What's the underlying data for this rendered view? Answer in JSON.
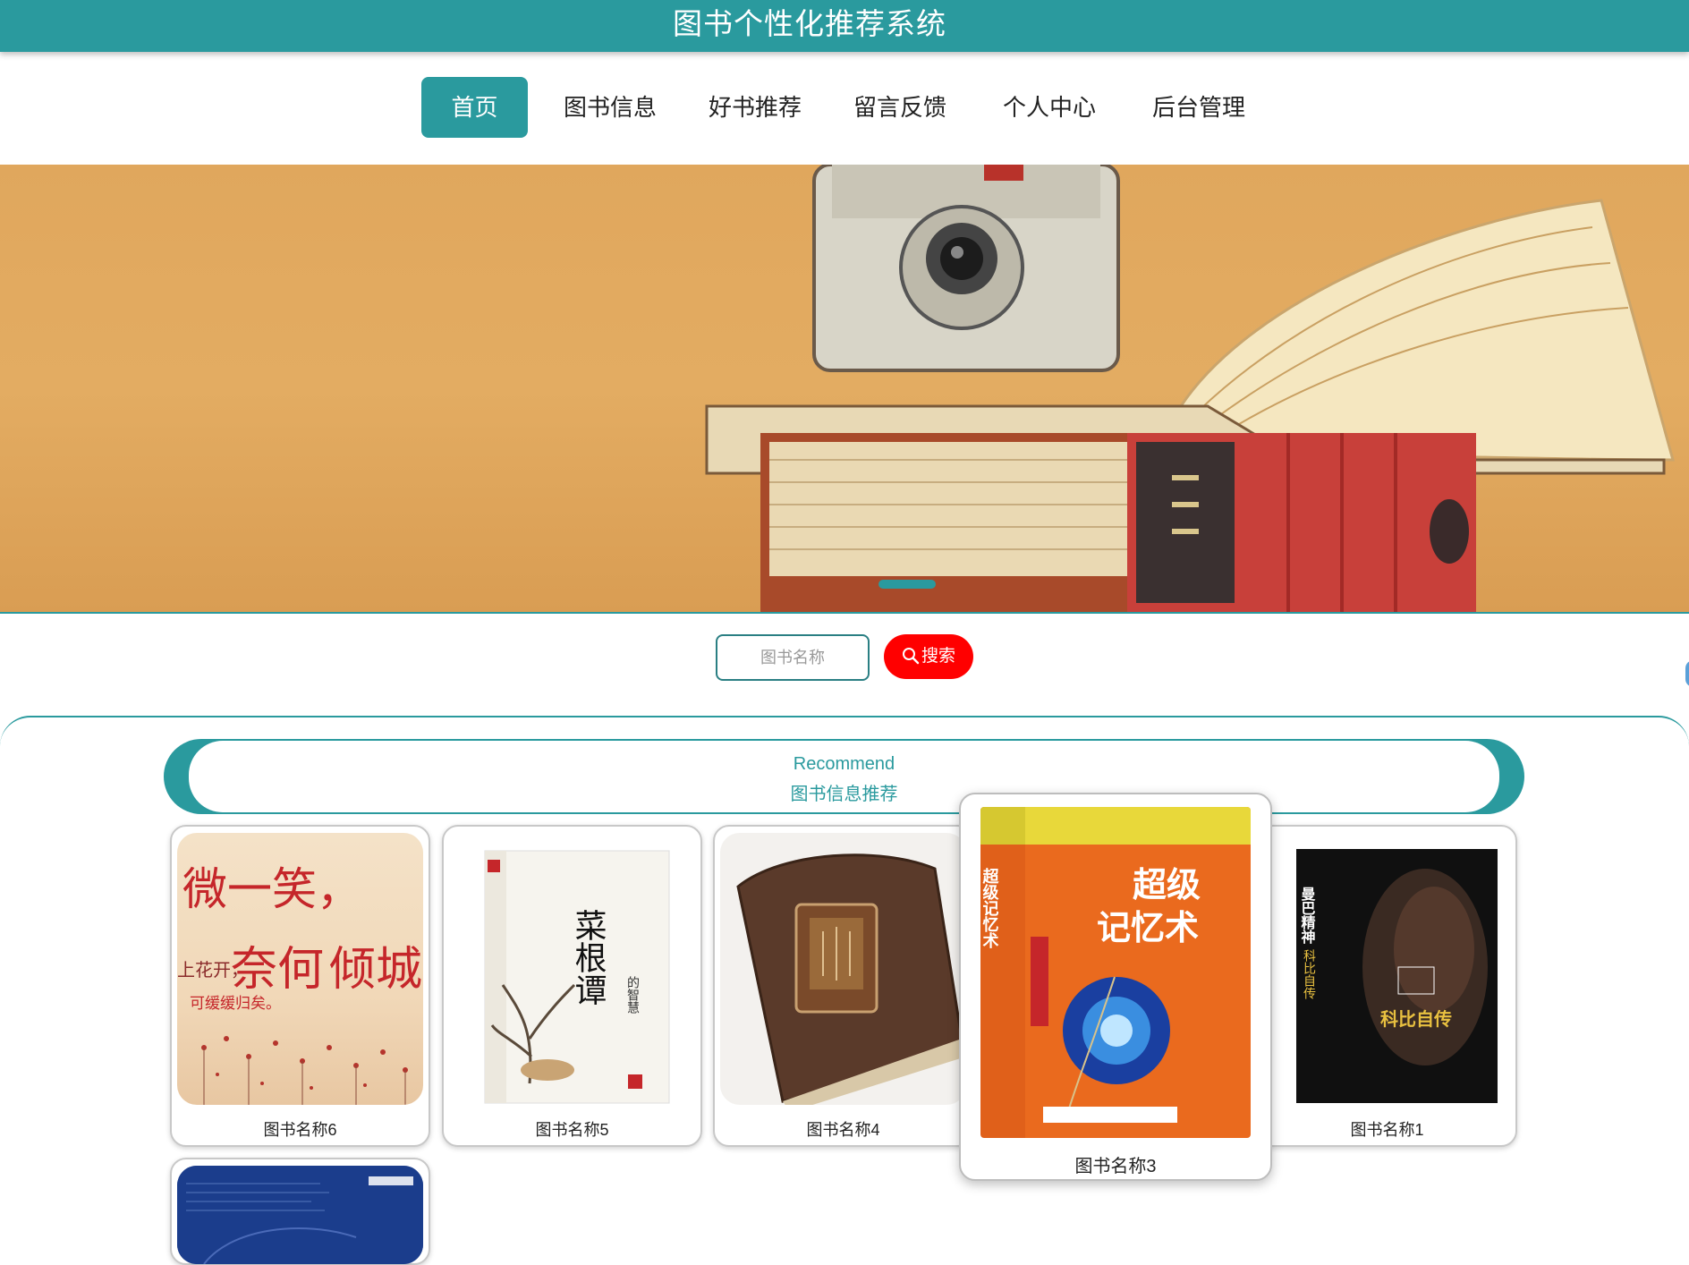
{
  "header": {
    "title": "图书个性化推荐系统"
  },
  "nav": {
    "items": [
      {
        "label": "首页",
        "active": true
      },
      {
        "label": "图书信息"
      },
      {
        "label": "好书推荐"
      },
      {
        "label": "留言反馈"
      },
      {
        "label": "个人中心"
      },
      {
        "label": "后台管理"
      }
    ]
  },
  "search": {
    "placeholder": "图书名称",
    "button_label": "搜索"
  },
  "recommend": {
    "title_en": "Recommend",
    "title_cn": "图书信息推荐",
    "books": [
      {
        "name": "图书名称6"
      },
      {
        "name": "图书名称5"
      },
      {
        "name": "图书名称4"
      },
      {
        "name": "图书名称3"
      },
      {
        "name": "图书名称1"
      },
      {
        "name": ""
      }
    ]
  },
  "covers": {
    "book6": {
      "line1": "微一笑，",
      "line2": "倾城",
      "line3": "可缓缓归矣。"
    },
    "book5": {
      "title": "菜根谭",
      "sub": "的智慧"
    },
    "book3": {
      "title": "超级记忆术"
    },
    "book1": {
      "title": "曼巴精神",
      "sub": "科比自传"
    }
  },
  "colors": {
    "primary": "#2a9a9e",
    "search_button": "#ff0000"
  }
}
